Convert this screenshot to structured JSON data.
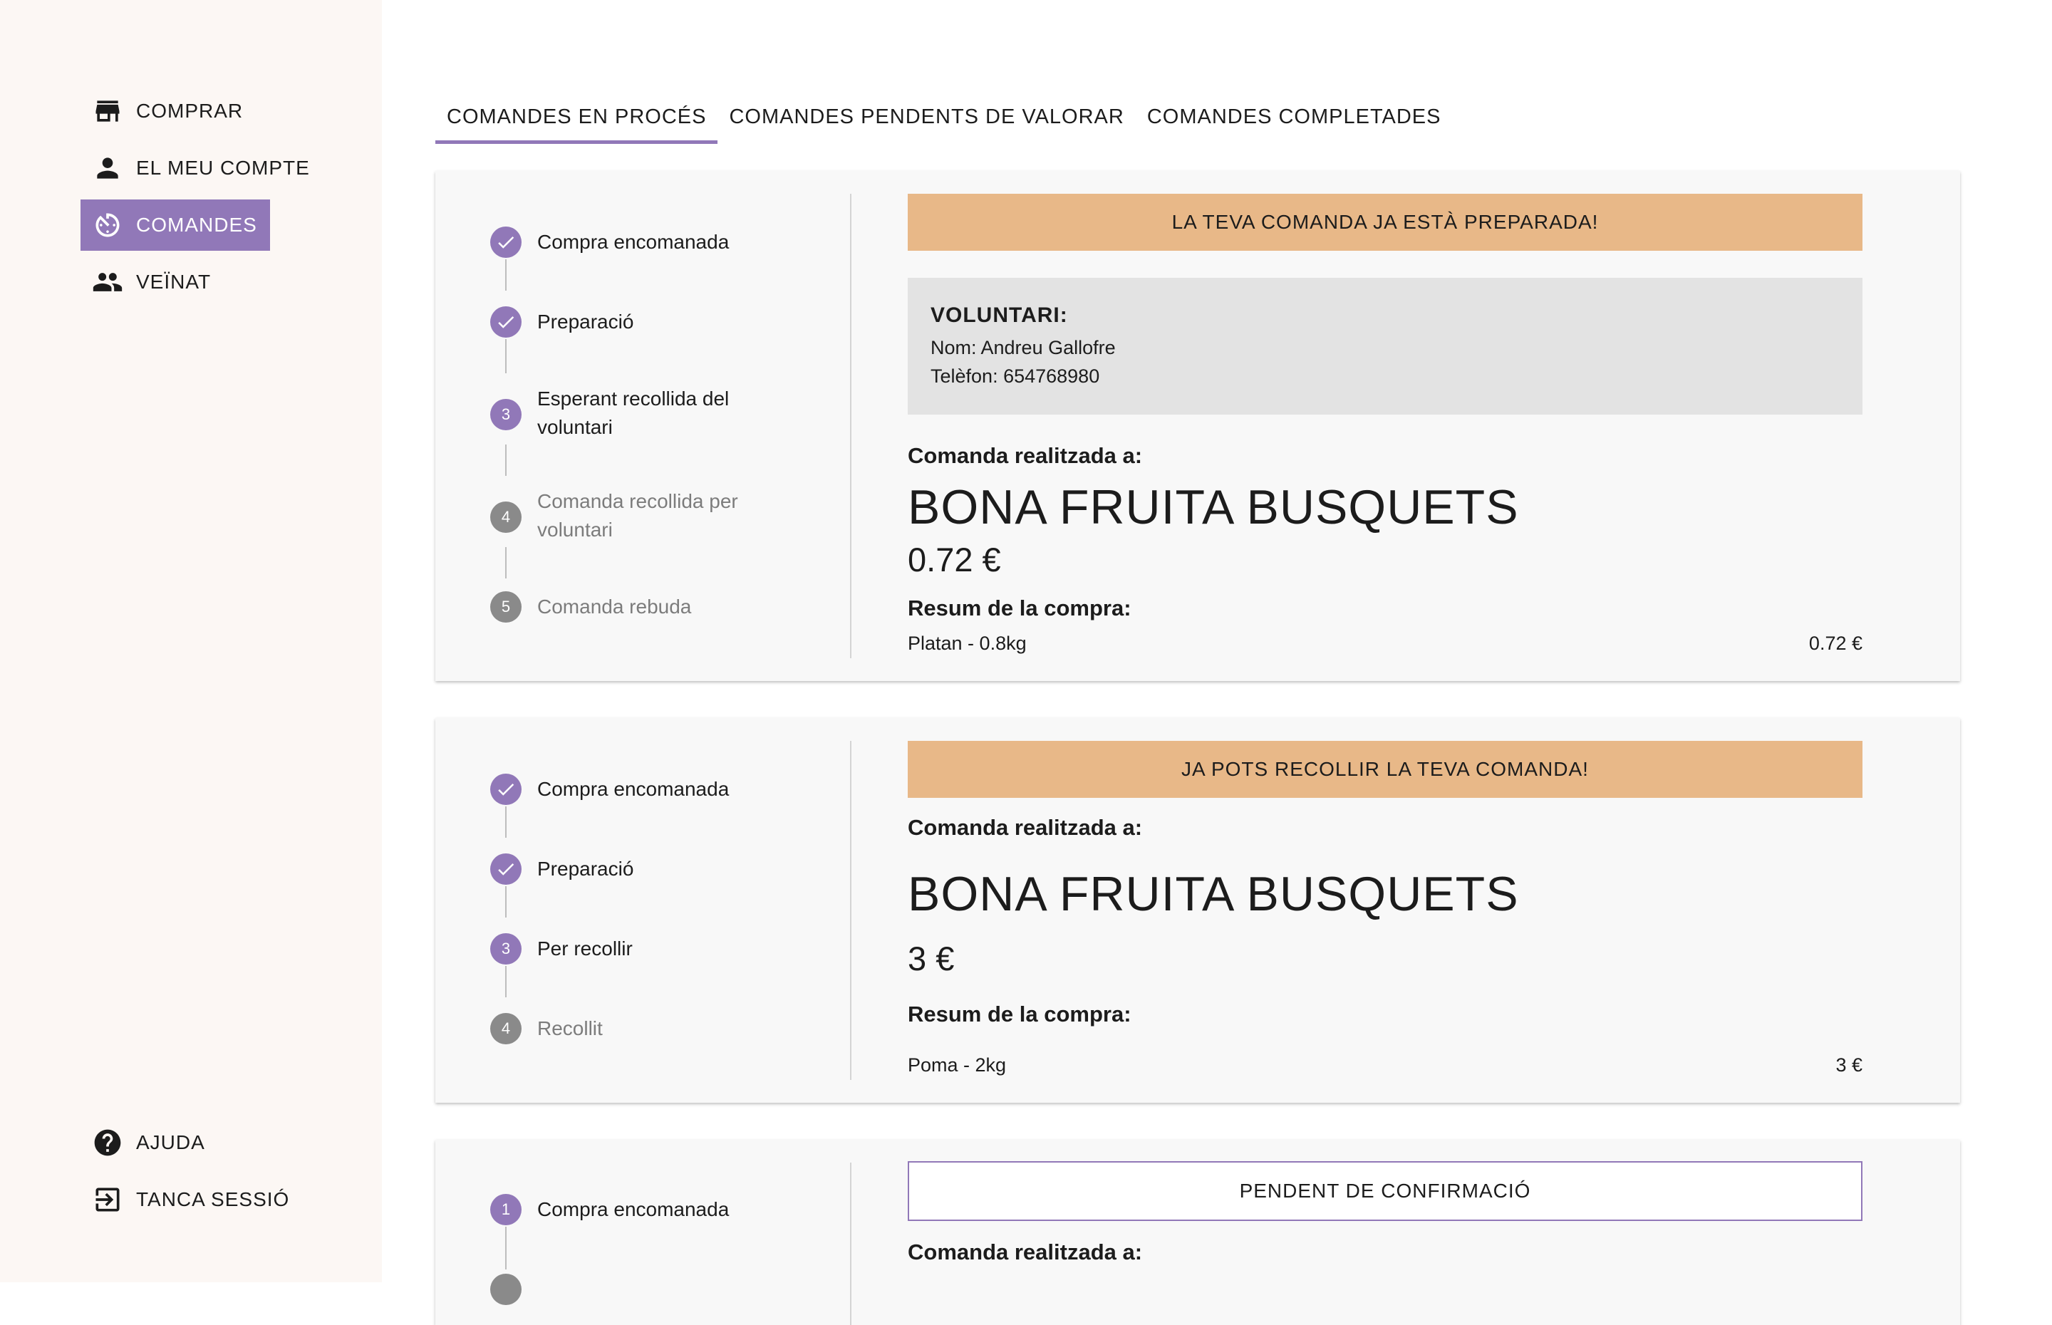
{
  "sidebar": {
    "top_items": [
      {
        "label": "COMPRAR",
        "icon": "store-icon"
      },
      {
        "label": "EL MEU COMPTE",
        "icon": "person-icon"
      },
      {
        "label": "COMANDES",
        "icon": "timer-icon",
        "active": true
      },
      {
        "label": "VEÏNAT",
        "icon": "group-icon"
      }
    ],
    "bottom_items": [
      {
        "label": "AJUDA",
        "icon": "help-icon"
      },
      {
        "label": "TANCA SESSIÓ",
        "icon": "logout-icon"
      }
    ]
  },
  "tabs": [
    {
      "label": "COMANDES EN PROCÉS",
      "active": true
    },
    {
      "label": "COMANDES PENDENTS DE VALORAR"
    },
    {
      "label": "COMANDES COMPLETADES"
    }
  ],
  "orders": [
    {
      "steps": [
        {
          "label": "Compra encomanada",
          "state": "done"
        },
        {
          "label": "Preparació",
          "state": "done"
        },
        {
          "label": "Esperant recollida del voluntari",
          "state": "current",
          "number": "3"
        },
        {
          "label": "Comanda recollida per voluntari",
          "state": "pending",
          "number": "4"
        },
        {
          "label": "Comanda rebuda",
          "state": "pending",
          "number": "5"
        }
      ],
      "banner": "LA TEVA COMANDA JA ESTÀ PREPARADA!",
      "volunteer": {
        "heading": "VOLUNTARI:",
        "name": "Nom: Andreu Gallofre",
        "phone": "Telèfon: 654768980"
      },
      "placed_at_label": "Comanda realitzada a:",
      "shop": "BONA FRUITA BUSQUETS",
      "total": "0.72 €",
      "summary_label": "Resum de la compra:",
      "items": [
        {
          "name": "Platan - 0.8kg",
          "price": "0.72 €"
        }
      ]
    },
    {
      "steps": [
        {
          "label": "Compra encomanada",
          "state": "done"
        },
        {
          "label": "Preparació",
          "state": "done"
        },
        {
          "label": "Per recollir",
          "state": "current",
          "number": "3"
        },
        {
          "label": "Recollit",
          "state": "pending",
          "number": "4"
        }
      ],
      "banner": "JA POTS RECOLLIR LA TEVA COMANDA!",
      "placed_at_label": "Comanda realitzada a:",
      "shop": "BONA FRUITA BUSQUETS",
      "total": "3 €",
      "summary_label": "Resum de la compra:",
      "items": [
        {
          "name": "Poma - 2kg",
          "price": "3 €"
        }
      ]
    },
    {
      "steps": [
        {
          "label": "Compra encomanada",
          "state": "current",
          "number": "1"
        }
      ],
      "banner": "PENDENT DE CONFIRMACIÓ",
      "placed_at_label": "Comanda realitzada a:"
    }
  ],
  "colors": {
    "accent": "#9178b8",
    "banner": "#e8b888",
    "sidebar_bg": "#fcf7f4",
    "card_bg": "#f8f8f8"
  }
}
